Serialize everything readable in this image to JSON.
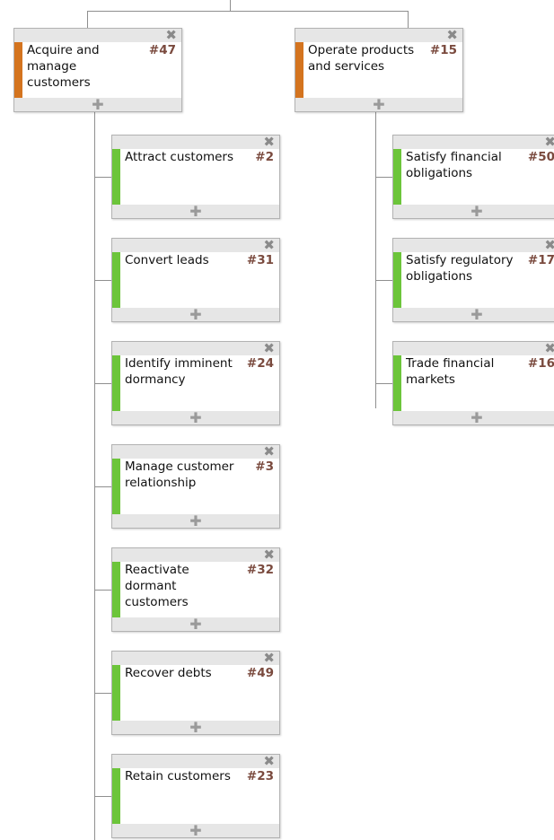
{
  "colors": {
    "parent_accent": "#d4741f",
    "child_accent": "#6cc53a",
    "connector": "#8f8f8f",
    "number_text": "#7a4a3e"
  },
  "icons": {
    "close": "✖",
    "add": "✚"
  },
  "columns": [
    {
      "parent": {
        "label": "Acquire and manage customers",
        "number": "#47"
      },
      "children": [
        {
          "label": "Attract customers",
          "number": "#2"
        },
        {
          "label": "Convert leads",
          "number": "#31"
        },
        {
          "label": "Identify imminent dormancy",
          "number": "#24"
        },
        {
          "label": "Manage customer relationship",
          "number": "#3"
        },
        {
          "label": "Reactivate dormant customers",
          "number": "#32"
        },
        {
          "label": "Recover debts",
          "number": "#49"
        },
        {
          "label": "Retain customers",
          "number": "#23"
        }
      ]
    },
    {
      "parent": {
        "label": "Operate products and services",
        "number": "#15"
      },
      "children": [
        {
          "label": "Satisfy financial obligations",
          "number": "#50"
        },
        {
          "label": "Satisfy regulatory obligations",
          "number": "#17"
        },
        {
          "label": "Trade financial markets",
          "number": "#16"
        }
      ]
    }
  ]
}
